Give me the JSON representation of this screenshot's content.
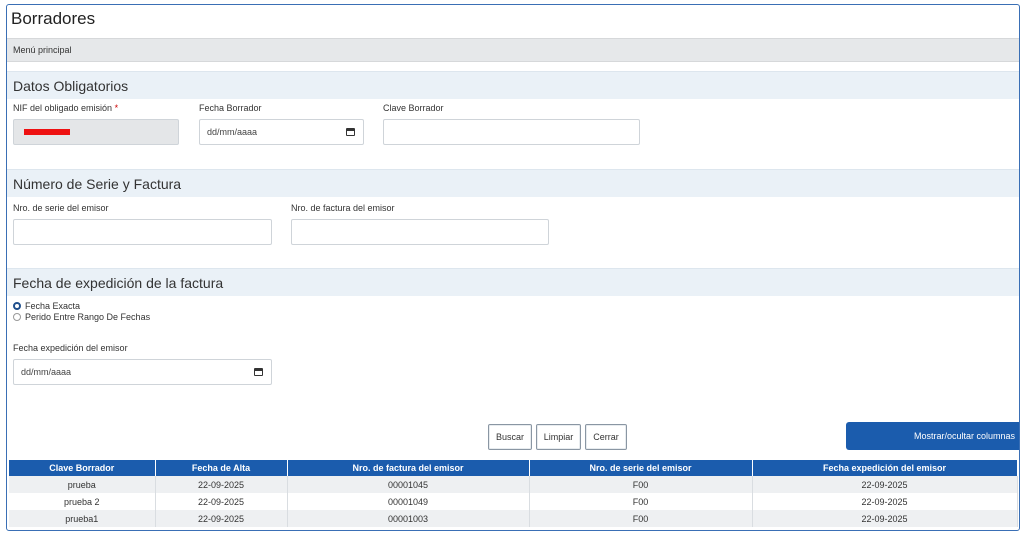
{
  "page": {
    "title": "Borradores"
  },
  "menu": {
    "breadcrumb": "Menú principal"
  },
  "datos": {
    "heading": "Datos Obligatorios",
    "nif_label": "NIF del obligado emisión",
    "nif_required_mark": "*",
    "fecha_borrador_label": "Fecha Borrador",
    "fecha_borrador_value": "dd/mm/aaaa",
    "clave_borrador_label": "Clave Borrador",
    "clave_borrador_value": ""
  },
  "serie": {
    "heading": "Número de Serie y Factura",
    "nro_serie_label": "Nro. de serie del emisor",
    "nro_serie_value": "",
    "nro_factura_label": "Nro. de factura del emisor",
    "nro_factura_value": ""
  },
  "expedicion": {
    "heading": "Fecha de expedición de la factura",
    "radio_exacta": "Fecha Exacta",
    "radio_rango": "Perido Entre Rango De Fechas",
    "selected": "exacta",
    "fecha_label": "Fecha expedición del emisor",
    "fecha_value": "dd/mm/aaaa"
  },
  "actions": {
    "buscar": "Buscar",
    "limpiar": "Limpiar",
    "cerrar": "Cerrar",
    "toggle_columns": "Mostrar/ocultar columnas"
  },
  "table": {
    "columns": [
      "Clave Borrador",
      "Fecha de Alta",
      "Nro. de factura del emisor",
      "Nro. de serie del emisor",
      "Fecha expedición del emisor"
    ],
    "rows": [
      [
        "prueba",
        "22-09-2025",
        "00001045",
        "F00",
        "22-09-2025"
      ],
      [
        "prueba 2",
        "22-09-2025",
        "00001049",
        "F00",
        "22-09-2025"
      ],
      [
        "prueba1",
        "22-09-2025",
        "00001003",
        "F00",
        "22-09-2025"
      ]
    ]
  },
  "colors": {
    "accent": "#1b5cad",
    "section_bg": "#eaf1f7",
    "redaction": "#ee1111"
  }
}
